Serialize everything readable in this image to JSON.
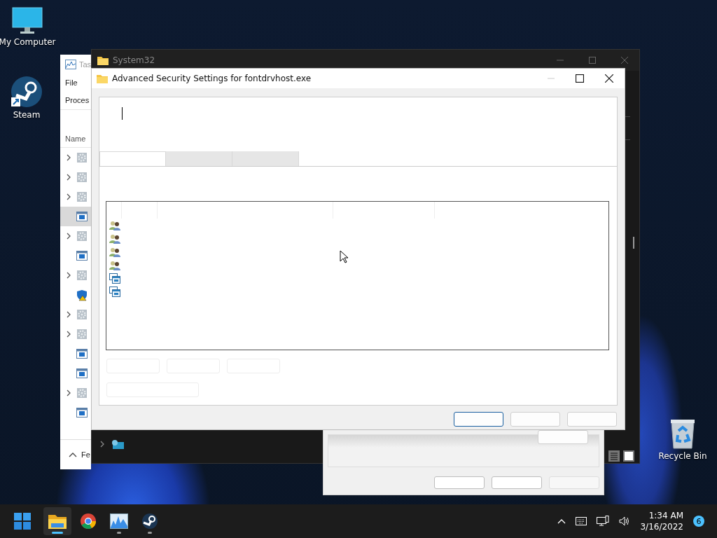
{
  "desktop": {
    "icons": [
      {
        "kind": "monitor",
        "label": "My Computer"
      },
      {
        "kind": "steam",
        "label": "Steam"
      },
      {
        "kind": "recycle",
        "label": "Recycle Bin"
      }
    ]
  },
  "task_manager": {
    "title": "Tas",
    "menu": [
      "File"
    ],
    "tab": "Proces",
    "column": "Name",
    "footer": "Fe",
    "rows": [
      {
        "kind": "gear",
        "expandable": true,
        "selected": false
      },
      {
        "kind": "gear",
        "expandable": true,
        "selected": false
      },
      {
        "kind": "gear",
        "expandable": true,
        "selected": false
      },
      {
        "kind": "app",
        "expandable": false,
        "selected": true
      },
      {
        "kind": "gear",
        "expandable": true,
        "selected": false
      },
      {
        "kind": "app",
        "expandable": false,
        "selected": false
      },
      {
        "kind": "gear",
        "expandable": true,
        "selected": false
      },
      {
        "kind": "shield",
        "expandable": false,
        "selected": false
      },
      {
        "kind": "gear",
        "expandable": true,
        "selected": false
      },
      {
        "kind": "gear",
        "expandable": true,
        "selected": false
      },
      {
        "kind": "app",
        "expandable": false,
        "selected": false
      },
      {
        "kind": "app",
        "expandable": false,
        "selected": false
      },
      {
        "kind": "gear",
        "expandable": true,
        "selected": false
      },
      {
        "kind": "app",
        "expandable": false,
        "selected": false
      }
    ]
  },
  "explorer": {
    "title": "System32"
  },
  "properties_window": {
    "buttons": [
      {
        "disabled": false
      },
      {
        "disabled": false
      },
      {
        "disabled": true
      }
    ]
  },
  "dialog": {
    "title": "Advanced Security Settings for fontdrvhost.exe",
    "tabs": [
      {
        "selected": true
      },
      {
        "selected": false
      },
      {
        "selected": false
      }
    ],
    "entries": [
      {
        "kind": "group"
      },
      {
        "kind": "group"
      },
      {
        "kind": "group"
      },
      {
        "kind": "group"
      },
      {
        "kind": "package"
      },
      {
        "kind": "package"
      }
    ],
    "buttons": [
      {
        "focused": true
      },
      {
        "focused": false
      },
      {
        "focused": false
      }
    ]
  },
  "taskbar": {
    "apps": [
      {
        "kind": "explorer",
        "active": true,
        "running": true
      },
      {
        "kind": "chrome",
        "active": false,
        "running": false
      },
      {
        "kind": "taskmanager",
        "active": false,
        "running": true
      },
      {
        "kind": "steam",
        "active": false,
        "running": true
      }
    ],
    "time": "1:34 AM",
    "date": "3/16/2022",
    "notifications": "6"
  }
}
